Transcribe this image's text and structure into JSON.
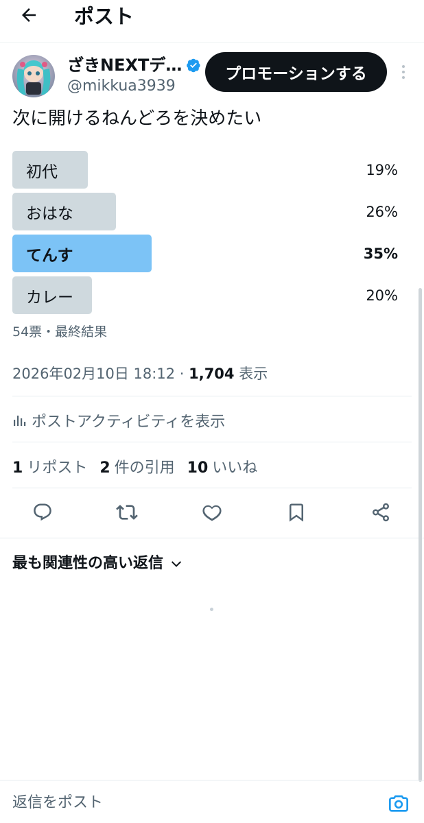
{
  "header": {
    "title": "ポスト",
    "back_icon": "arrow-left-icon"
  },
  "author": {
    "display_name": "ざきNEXTデ…",
    "handle": "@mikkua3939",
    "verified": true,
    "verified_color": "#1d9bf0"
  },
  "promote_label": "プロモーションする",
  "post": {
    "text": "次に開けるねんどろを決めたい"
  },
  "poll": {
    "options": [
      {
        "label": "初代",
        "percent_text": "19%",
        "percent": 19,
        "winner": false
      },
      {
        "label": "おはな",
        "percent_text": "26%",
        "percent": 26,
        "winner": false
      },
      {
        "label": "てんす",
        "percent_text": "35%",
        "percent": 35,
        "winner": true
      },
      {
        "label": "カレー",
        "percent_text": "20%",
        "percent": 20,
        "winner": false
      }
    ],
    "meta": "54票・最終結果",
    "bar_color": "#cfd9de",
    "winner_color": "#7cc3f6"
  },
  "timestamp": {
    "datetime": "2026年02月10日 18:12 · ",
    "views_count": "1,704",
    "views_label": " 表示"
  },
  "activity_label": "ポストアクティビティを表示",
  "stats": {
    "reposts_num": "1",
    "reposts_label": "リポスト",
    "quotes_num": "2",
    "quotes_label": "件の引用",
    "likes_num": "10",
    "likes_label": "いいね"
  },
  "actions": [
    "reply-icon",
    "repost-icon",
    "like-icon",
    "bookmark-icon",
    "share-icon"
  ],
  "replies_sort_label": "最も関連性の高い返信",
  "reply_placeholder": "返信をポスト",
  "colors": {
    "text": "#0f1419",
    "secondary": "#536471",
    "accent": "#1d9bf0"
  }
}
